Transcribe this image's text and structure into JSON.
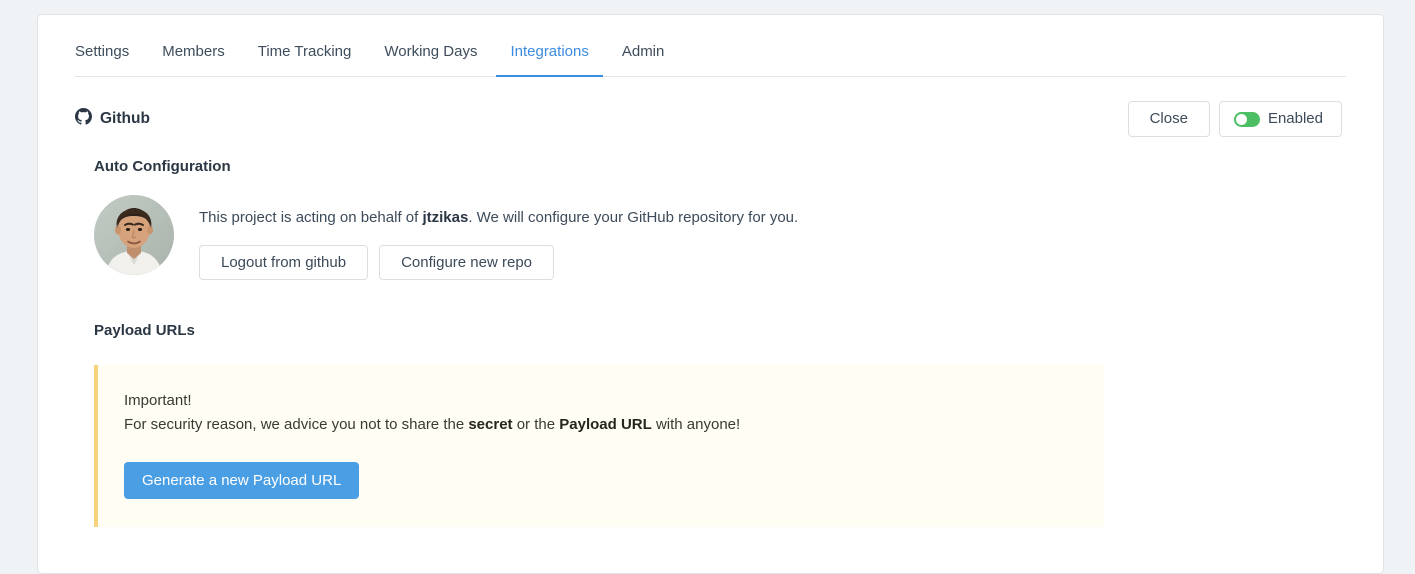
{
  "tabs": [
    {
      "label": "Settings",
      "active": false
    },
    {
      "label": "Members",
      "active": false
    },
    {
      "label": "Time Tracking",
      "active": false
    },
    {
      "label": "Working Days",
      "active": false
    },
    {
      "label": "Integrations",
      "active": true
    },
    {
      "label": "Admin",
      "active": false
    }
  ],
  "integration": {
    "name": "Github",
    "icon": "github-icon",
    "close_label": "Close",
    "toggle_label": "Enabled",
    "toggle_state": "on",
    "toggle_color": "#4cbf63"
  },
  "auto_configuration": {
    "heading": "Auto Configuration",
    "avatar_alt": "user-avatar",
    "behalf_prefix": "This project is acting on behalf of ",
    "behalf_user": "jtzikas",
    "behalf_suffix": ". We will configure your GitHub repository for you.",
    "logout_label": "Logout from github",
    "configure_label": "Configure new repo"
  },
  "payload_urls": {
    "heading": "Payload URLs",
    "notice": {
      "title": "Important!",
      "body_prefix": "For security reason, we advice you not to share the ",
      "body_bold_1": "secret",
      "body_middle": " or the ",
      "body_bold_2": "Payload URL",
      "body_suffix": " with anyone!",
      "accent_color": "#f6d37a",
      "background_color": "#fffdf4"
    },
    "generate_label": "Generate a new Payload URL",
    "generate_color": "#4a9ee3"
  },
  "theme": {
    "page_background": "#eff3f5",
    "card_background": "#ffffff",
    "accent": "#3c8ce0"
  }
}
